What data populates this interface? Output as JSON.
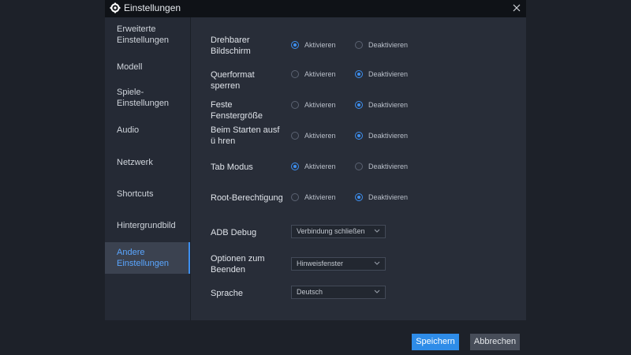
{
  "window": {
    "title": "Einstellungen"
  },
  "sidebar": {
    "items": [
      {
        "label": "Erweiterte Einstellungen"
      },
      {
        "label": "Modell"
      },
      {
        "label": "Spiele-Einstellungen"
      },
      {
        "label": "Audio"
      },
      {
        "label": "Netzwerk"
      },
      {
        "label": "Shortcuts"
      },
      {
        "label": "Hintergrundbild"
      },
      {
        "label": "Andere Einstellungen",
        "active": true
      }
    ]
  },
  "options": {
    "enable_label": "Aktivieren",
    "disable_label": "Deaktivieren",
    "rows": [
      {
        "label": "Drehbarer Bildschirm",
        "selected": "Aktivieren"
      },
      {
        "label": "Querformat sperren",
        "selected": "Deaktivieren"
      },
      {
        "label": "Feste Fenstergröße",
        "selected": "Deaktivieren"
      },
      {
        "label": "Beim Starten ausfü hren",
        "selected": "Deaktivieren"
      },
      {
        "label": "Tab Modus",
        "selected": "Aktivieren"
      },
      {
        "label": "Root-Berechtigung",
        "selected": "Deaktivieren"
      }
    ]
  },
  "selects": {
    "adb": {
      "label": "ADB Debug",
      "value": "Verbindung schließen"
    },
    "exit": {
      "label": "Optionen zum Beenden",
      "value": "Hinweisfenster"
    },
    "language": {
      "label": "Sprache",
      "value": "Deutsch"
    }
  },
  "footer": {
    "save_label": "Speichern",
    "cancel_label": "Abbrechen"
  },
  "colors": {
    "accent": "#2e8ce8",
    "active_text": "#5aa6ff",
    "window_bg": "#252a35"
  }
}
